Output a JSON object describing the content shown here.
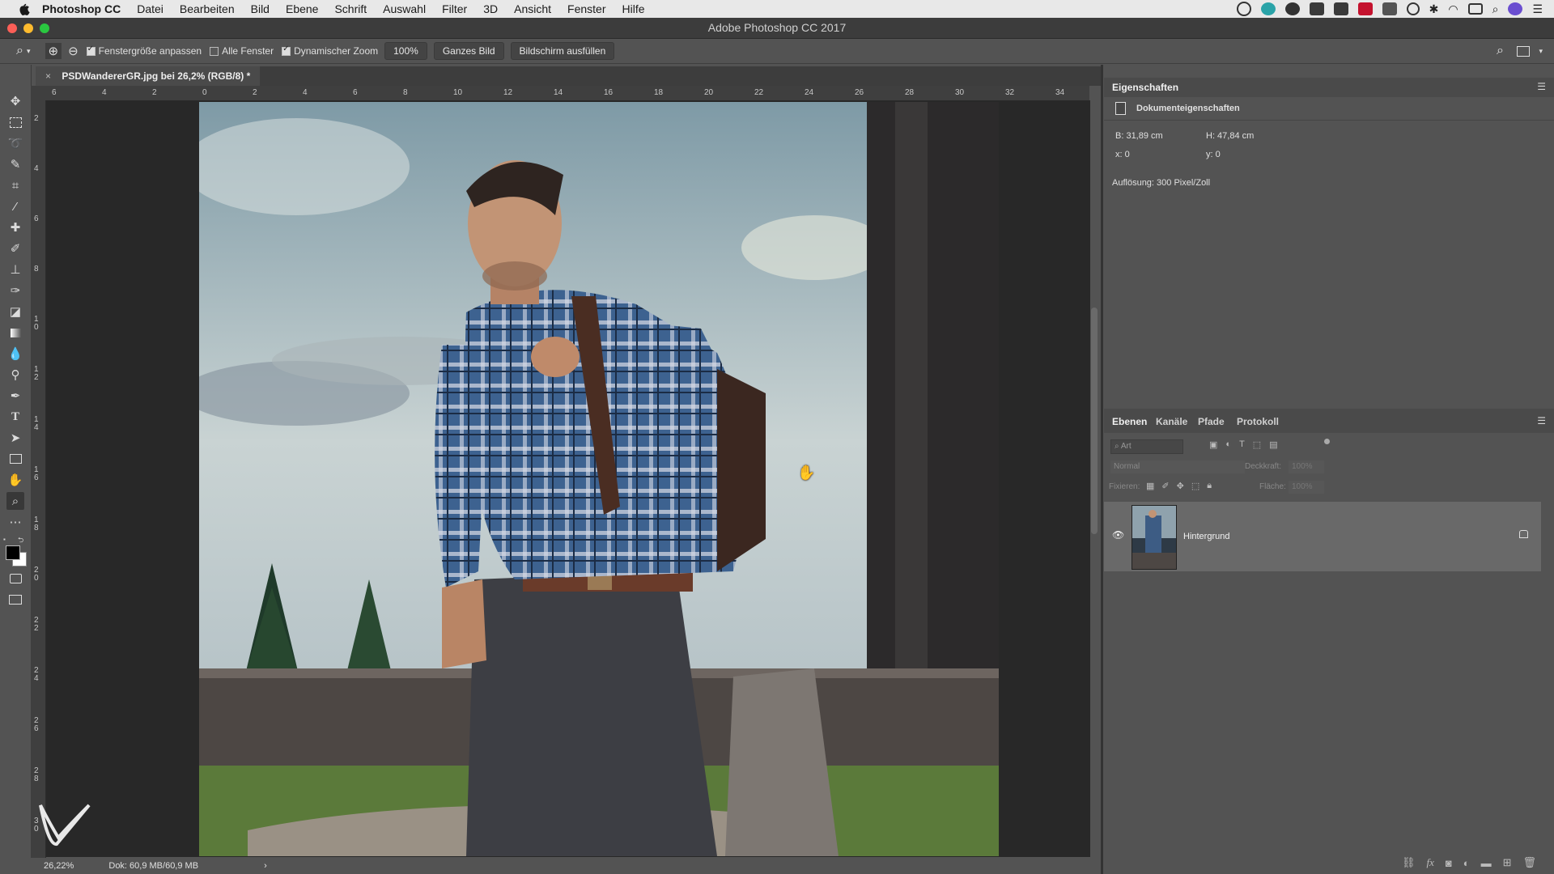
{
  "menubar": {
    "app_name": "Photoshop CC",
    "items": [
      "Datei",
      "Bearbeiten",
      "Bild",
      "Ebene",
      "Schrift",
      "Auswahl",
      "Filter",
      "3D",
      "Ansicht",
      "Fenster",
      "Hilfe"
    ]
  },
  "window": {
    "title": "Adobe Photoshop CC 2017"
  },
  "options_bar": {
    "fit_window": "Fenstergröße anpassen",
    "all_windows": "Alle Fenster",
    "dynamic_zoom": "Dynamischer Zoom",
    "zoom_100": "100%",
    "whole_image": "Ganzes Bild",
    "fill_screen": "Bildschirm ausfüllen",
    "fit_window_checked": true,
    "all_windows_checked": false,
    "dynamic_zoom_checked": true
  },
  "document": {
    "tab_title": "PSDWandererGR.jpg bei 26,2% (RGB/8) *",
    "close": "×"
  },
  "rulers": {
    "top_labels": [
      "6",
      "4",
      "2",
      "0",
      "2",
      "4",
      "6",
      "8",
      "10",
      "12",
      "14",
      "16",
      "18",
      "20",
      "22",
      "24",
      "26",
      "28",
      "30",
      "32",
      "34"
    ],
    "left_labels": [
      "2",
      "4",
      "6",
      "8",
      "1 0",
      "1 2",
      "1 4",
      "1 6",
      "1 8",
      "2 0",
      "2 2",
      "2 4",
      "2 6",
      "2 8",
      "3 0"
    ]
  },
  "status": {
    "zoom": "26,22%",
    "doc_size": "Dok: 60,9 MB/60,9 MB",
    "arrow": "›"
  },
  "properties": {
    "tab": "Eigenschaften",
    "section": "Dokumenteigenschaften",
    "width": "B: 31,89 cm",
    "height": "H: 47,84 cm",
    "x": "x: 0",
    "y": "y: 0",
    "resolution": "Auflösung: 300 Pixel/Zoll"
  },
  "layers_panel": {
    "tabs": [
      "Ebenen",
      "Kanäle",
      "Pfade",
      "Protokoll"
    ],
    "filter_placeholder": "Art",
    "blend_mode": "Normal",
    "opacity_label": "Deckkraft:",
    "opacity_value": "100%",
    "lock_label": "Fixieren:",
    "fill_label": "Fläche:",
    "fill_value": "100%",
    "layers": [
      {
        "name": "Hintergrund",
        "visible": true,
        "locked": true
      }
    ]
  },
  "colors": {
    "panel_bg": "#535353",
    "canvas_bg": "#282828",
    "menubar_bg": "#e8e8e8",
    "sky": "#aebcc4"
  }
}
